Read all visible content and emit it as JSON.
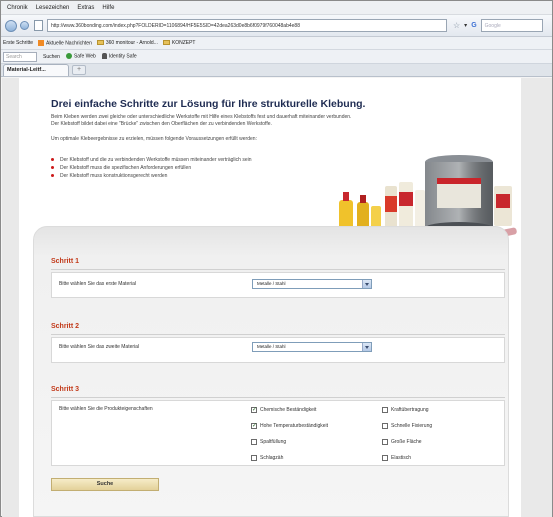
{
  "browser": {
    "menu": [
      "Chronik",
      "Lesezeichen",
      "Extras",
      "Hilfe"
    ],
    "url": "http://www.360bonding.com/index.php?FOLDERID=1106894/HF5E5SID=42dea263d0e8b6f0979f760048ab4e88",
    "search_placeholder": "Google",
    "bookmarks": [
      "Erste Schritte",
      "Aktuelle Nachrichten",
      "360 monitour - Arnold...",
      "KONZEPT"
    ],
    "toolbar": {
      "search_placeholder": "Search",
      "search_button": "Suchen",
      "safe_web": "Safe Web",
      "identity_safe": "Identity Safe"
    },
    "tab_title": "Material-Leitf...",
    "new_tab": "+"
  },
  "page": {
    "title": "Drei einfache Schritte zur Lösung für Ihre strukturelle Klebung.",
    "intro_lines": [
      "Beim Kleben werden zwei gleiche oder unterschiedliche Werkstoffe mit Hilfe eines Klebstoffs fest und dauerhaft miteinander verbunden.",
      "Der Klebstoff bildet dabei eine \"Brücke\" zwischen den Oberflächen der zu verbindenden Werkstoffe.",
      "Um optimale Klebeergebnisse zu erzielen, müssen folgende Voraussetzungen erfüllt werden:"
    ],
    "bullets": [
      "Der Klebstoff und die zu verbindenden Werkstoffe müssen miteinander verträglich sein",
      "Der Klebstoff muss die spezifischen Anforderungen erfüllen",
      "Der Klebstoff muss konstruktionsgerecht werden"
    ]
  },
  "steps": [
    {
      "title": "Schritt 1",
      "label": "Bitte wählen Sie das erste Material",
      "value": "Metalle / Stahl"
    },
    {
      "title": "Schritt 2",
      "label": "Bitte wählen Sie das zweite Material",
      "value": "Metalle / Stahl"
    },
    {
      "title": "Schritt 3",
      "label": "Bitte wählen Sie die Produkteigenschaften"
    }
  ],
  "properties": [
    {
      "label": "Chemische Beständigkeit",
      "checked": true
    },
    {
      "label": "Kraftübertragung",
      "checked": false
    },
    {
      "label": "Hohe Temperaturbeständigkeit",
      "checked": true
    },
    {
      "label": "Schnelle Fixierung",
      "checked": false
    },
    {
      "label": "Spaltfüllung",
      "checked": false
    },
    {
      "label": "Große Fläche",
      "checked": false
    },
    {
      "label": "Schlagzäh",
      "checked": false
    },
    {
      "label": "Elastisch",
      "checked": false
    }
  ],
  "submit_label": "Suche",
  "colors": {
    "title": "#1f2c52",
    "step": "#c23a1a",
    "bullet": "#cc1a1a"
  }
}
